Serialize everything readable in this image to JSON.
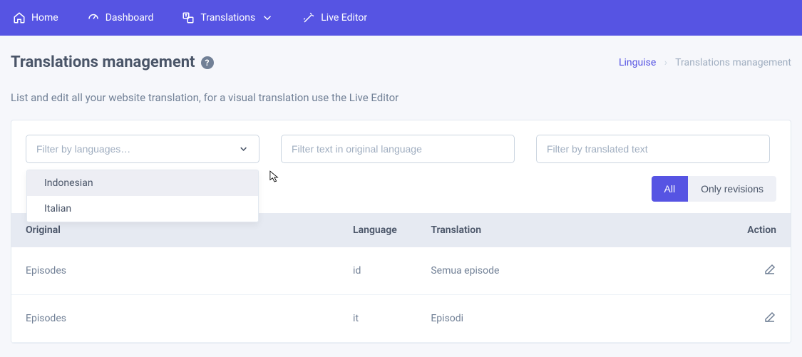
{
  "nav": {
    "home": "Home",
    "dashboard": "Dashboard",
    "translations": "Translations",
    "live_editor": "Live Editor"
  },
  "page": {
    "title": "Translations management",
    "subtitle": "List and edit all your website translation, for a visual translation use the Live Editor"
  },
  "crumbs": {
    "root": "Linguise",
    "current": "Translations management"
  },
  "filters": {
    "lang_placeholder": "Filter by languages…",
    "original_placeholder": "Filter text in original language",
    "translated_placeholder": "Filter by translated text",
    "dropdown": [
      "Indonesian",
      "Italian"
    ]
  },
  "seg": {
    "all": "All",
    "rev": "Only revisions"
  },
  "table": {
    "headers": {
      "original": "Original",
      "language": "Language",
      "translation": "Translation",
      "action": "Action"
    },
    "rows": [
      {
        "original": "Episodes",
        "language": "id",
        "translation": "Semua episode"
      },
      {
        "original": "Episodes",
        "language": "it",
        "translation": "Episodi"
      }
    ]
  }
}
